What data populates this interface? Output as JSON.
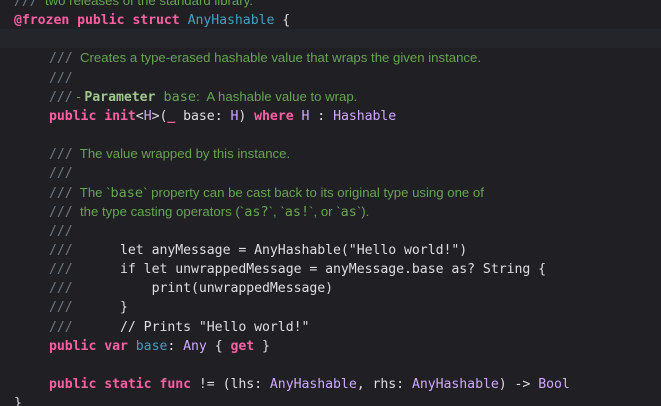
{
  "editor": {
    "lines": [
      {
        "indent": "",
        "tokens": [
          {
            "t": "///",
            "c": "c-comment code"
          },
          {
            "t": "  two releases of the standard library.",
            "c": "c-doc doc"
          }
        ]
      },
      {
        "indent": "",
        "tokens": [
          {
            "t": "@frozen public struct",
            "c": "c-key code"
          },
          {
            "t": " ",
            "c": "c-text code"
          },
          {
            "t": "AnyHashable",
            "c": "c-decl code"
          },
          {
            "t": " {",
            "c": "c-text code"
          }
        ]
      },
      {
        "indent": "",
        "tokens": [],
        "current": true
      },
      {
        "indent": "    ",
        "tokens": [
          {
            "t": "///",
            "c": "c-comment code"
          },
          {
            "t": "  Creates a type-erased hashable value that wraps the given instance.",
            "c": "c-doc doc"
          }
        ]
      },
      {
        "indent": "    ",
        "tokens": [
          {
            "t": "///",
            "c": "c-comment code"
          }
        ]
      },
      {
        "indent": "    ",
        "tokens": [
          {
            "t": "///",
            "c": "c-comment code"
          },
          {
            "t": " - ",
            "c": "c-doc doc"
          },
          {
            "t": "Parameter",
            "c": "c-docbold code"
          },
          {
            "t": " base",
            "c": "c-docmono"
          },
          {
            "t": ":  A hashable value to wrap.",
            "c": "c-doc doc"
          }
        ]
      },
      {
        "indent": "    ",
        "tokens": [
          {
            "t": "public init",
            "c": "c-key code"
          },
          {
            "t": "<",
            "c": "c-text code"
          },
          {
            "t": "H",
            "c": "c-type code"
          },
          {
            "t": ">(",
            "c": "c-text code"
          },
          {
            "t": "_",
            "c": "c-key code"
          },
          {
            "t": " base: ",
            "c": "c-text code"
          },
          {
            "t": "H",
            "c": "c-type code"
          },
          {
            "t": ") ",
            "c": "c-text code"
          },
          {
            "t": "where",
            "c": "c-key code"
          },
          {
            "t": " ",
            "c": "c-text code"
          },
          {
            "t": "H",
            "c": "c-type code"
          },
          {
            "t": " : ",
            "c": "c-text code"
          },
          {
            "t": "Hashable",
            "c": "c-type code"
          }
        ]
      },
      {
        "indent": "",
        "tokens": []
      },
      {
        "indent": "    ",
        "tokens": [
          {
            "t": "///",
            "c": "c-comment code"
          },
          {
            "t": "  The value wrapped by this instance.",
            "c": "c-doc doc"
          }
        ]
      },
      {
        "indent": "    ",
        "tokens": [
          {
            "t": "///",
            "c": "c-comment code"
          }
        ]
      },
      {
        "indent": "    ",
        "tokens": [
          {
            "t": "///",
            "c": "c-comment code"
          },
          {
            "t": "  The `",
            "c": "c-doc doc"
          },
          {
            "t": "base",
            "c": "c-docmono"
          },
          {
            "t": "` property can be cast back to its original type using one of",
            "c": "c-doc doc"
          }
        ]
      },
      {
        "indent": "    ",
        "tokens": [
          {
            "t": "///",
            "c": "c-comment code"
          },
          {
            "t": "  the type casting operators (`",
            "c": "c-doc doc"
          },
          {
            "t": "as?",
            "c": "c-docmono"
          },
          {
            "t": "`, `",
            "c": "c-doc doc"
          },
          {
            "t": "as!",
            "c": "c-docmono"
          },
          {
            "t": "`, or `",
            "c": "c-doc doc"
          },
          {
            "t": "as",
            "c": "c-docmono"
          },
          {
            "t": "`).",
            "c": "c-doc doc"
          }
        ]
      },
      {
        "indent": "    ",
        "tokens": [
          {
            "t": "///",
            "c": "c-comment code"
          }
        ]
      },
      {
        "indent": "    ",
        "tokens": [
          {
            "t": "///",
            "c": "c-comment code"
          },
          {
            "t": "      let anyMessage = AnyHashable(\"Hello world!\")",
            "c": "c-text code"
          }
        ]
      },
      {
        "indent": "    ",
        "tokens": [
          {
            "t": "///",
            "c": "c-comment code"
          },
          {
            "t": "      if let unwrappedMessage = anyMessage.base as? String {",
            "c": "c-text code"
          }
        ]
      },
      {
        "indent": "    ",
        "tokens": [
          {
            "t": "///",
            "c": "c-comment code"
          },
          {
            "t": "          print(unwrappedMessage)",
            "c": "c-text code"
          }
        ]
      },
      {
        "indent": "    ",
        "tokens": [
          {
            "t": "///",
            "c": "c-comment code"
          },
          {
            "t": "      }",
            "c": "c-text code"
          }
        ]
      },
      {
        "indent": "    ",
        "tokens": [
          {
            "t": "///",
            "c": "c-comment code"
          },
          {
            "t": "      // Prints \"Hello world!\"",
            "c": "c-text code"
          }
        ]
      },
      {
        "indent": "    ",
        "tokens": [
          {
            "t": "public var",
            "c": "c-key code"
          },
          {
            "t": " ",
            "c": "c-text code"
          },
          {
            "t": "base",
            "c": "c-decl code"
          },
          {
            "t": ": ",
            "c": "c-text code"
          },
          {
            "t": "Any",
            "c": "c-type code"
          },
          {
            "t": " { ",
            "c": "c-text code"
          },
          {
            "t": "get",
            "c": "c-key code"
          },
          {
            "t": " }",
            "c": "c-text code"
          }
        ]
      },
      {
        "indent": "",
        "tokens": []
      },
      {
        "indent": "    ",
        "tokens": [
          {
            "t": "public static func",
            "c": "c-key code"
          },
          {
            "t": " != (lhs: ",
            "c": "c-text code"
          },
          {
            "t": "AnyHashable",
            "c": "c-type code"
          },
          {
            "t": ", rhs: ",
            "c": "c-text code"
          },
          {
            "t": "AnyHashable",
            "c": "c-type code"
          },
          {
            "t": ") -> ",
            "c": "c-text code"
          },
          {
            "t": "Bool",
            "c": "c-type code"
          }
        ]
      },
      {
        "indent": "",
        "tokens": [
          {
            "t": "}",
            "c": "c-text code"
          }
        ]
      }
    ]
  },
  "colors": {
    "background": "#1f1f24",
    "keyword": "#fc5fa3",
    "type": "#d0a8ff",
    "declaration": "#41a1c0",
    "doc_comment": "#67a552",
    "plain_text": "#dfdfe0"
  }
}
